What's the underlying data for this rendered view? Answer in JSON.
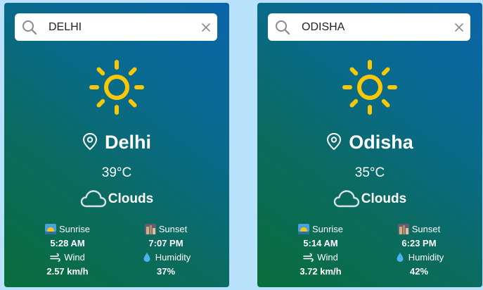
{
  "colors": {
    "background": "#b8e2fb",
    "card_gradient_top": "#0b64a8",
    "card_gradient_bottom": "#0a6e3c",
    "sun": "#f8c806",
    "text": "#ffffff"
  },
  "cards": [
    {
      "search": {
        "value": "DELHI",
        "icon": "search-icon",
        "clear_icon": "close-icon"
      },
      "weather_icon": "sun-icon",
      "city": "Delhi",
      "temperature": "39°C",
      "condition": "Clouds",
      "stats": {
        "sunrise": {
          "label": "Sunrise",
          "value": "5:28 AM"
        },
        "sunset": {
          "label": "Sunset",
          "value": "7:07 PM"
        },
        "wind": {
          "label": "Wind",
          "value": "2.57 km/h"
        },
        "humidity": {
          "label": "Humidity",
          "value": "37%"
        }
      }
    },
    {
      "search": {
        "value": "ODISHA",
        "icon": "search-icon",
        "clear_icon": "close-icon"
      },
      "weather_icon": "sun-icon",
      "city": "Odisha",
      "temperature": "35°C",
      "condition": "Clouds",
      "stats": {
        "sunrise": {
          "label": "Sunrise",
          "value": "5:14 AM"
        },
        "sunset": {
          "label": "Sunset",
          "value": "6:23 PM"
        },
        "wind": {
          "label": "Wind",
          "value": "3.72 km/h"
        },
        "humidity": {
          "label": "Humidity",
          "value": "42%"
        }
      }
    }
  ]
}
